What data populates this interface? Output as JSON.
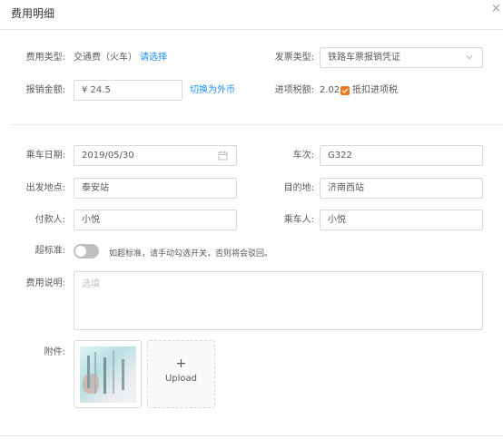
{
  "dialog": {
    "title": "费用明细",
    "close_glyph": "×"
  },
  "expense_type": {
    "label": "费用类型:",
    "value": "交通费（火车）",
    "action": "请选择"
  },
  "invoice_type": {
    "label": "发票类型:",
    "value": "铁路车票报销凭证"
  },
  "amount": {
    "label": "报销金额:",
    "value": "¥ 24.5",
    "action": "切换为外币"
  },
  "input_tax": {
    "label": "进项税额:",
    "value": "2.02",
    "checkbox_label": "抵扣进项税",
    "checked": true,
    "checkbox_color": "#f07a1e"
  },
  "ride_date": {
    "label": "乘车日期:",
    "value": "2019/05/30"
  },
  "train_no": {
    "label": "车次:",
    "value": "G322"
  },
  "departure": {
    "label": "出发地点:",
    "value": "泰安站"
  },
  "destination": {
    "label": "目的地:",
    "value": "济南西站"
  },
  "payer": {
    "label": "付款人:",
    "value": "小悦"
  },
  "passenger": {
    "label": "乘车人:",
    "value": "小悦"
  },
  "over_standard": {
    "label": "超标准:",
    "on": false,
    "hint": "如超标准，请手动勾选开关，否则将会驳回。"
  },
  "description": {
    "label": "费用说明:",
    "placeholder": "选填",
    "value": ""
  },
  "attachments": {
    "label": "附件:",
    "upload_label": "Upload",
    "upload_glyph": "+"
  },
  "colors": {
    "link": "#1890ff",
    "border": "#d9d9d9",
    "text": "#595959",
    "placeholder": "#bfbfbf"
  }
}
